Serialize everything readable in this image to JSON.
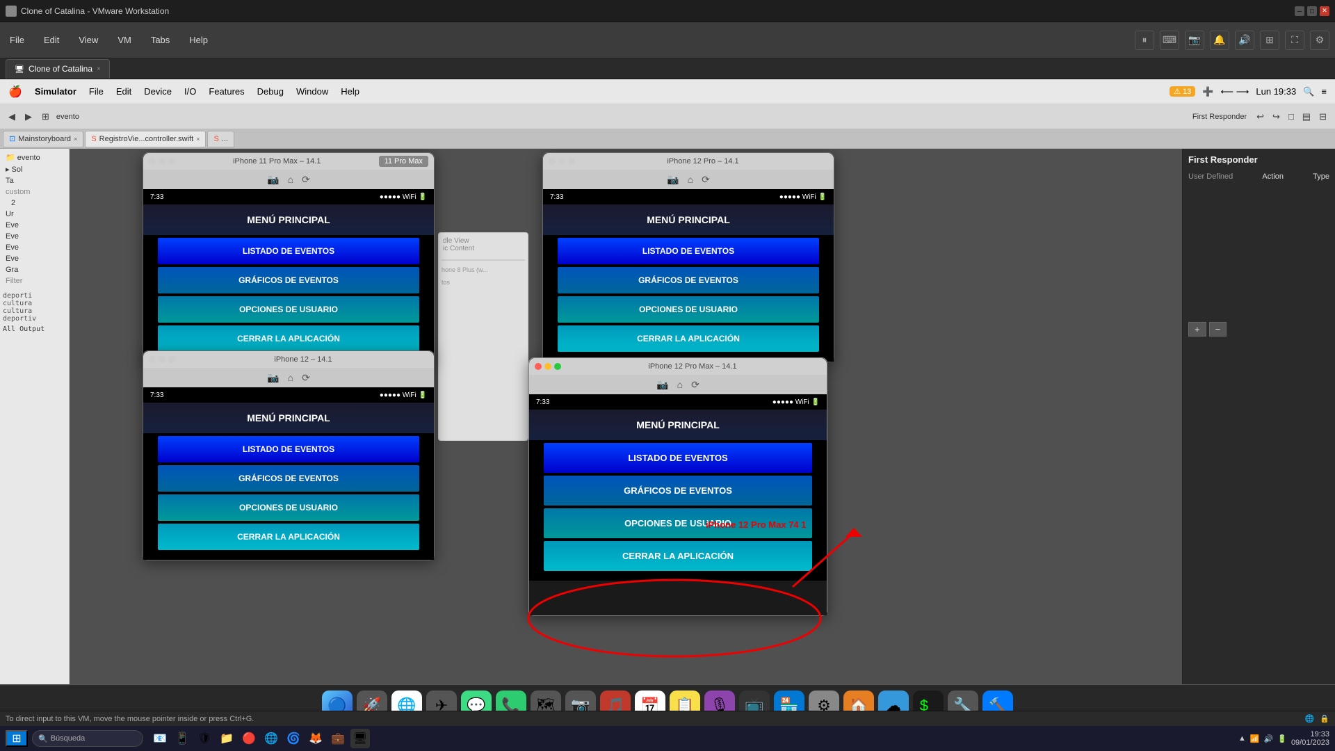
{
  "window": {
    "title": "Clone of Catalina - VMware Workstation",
    "icon": "vmware-icon"
  },
  "vmware_menu": {
    "items": [
      "File",
      "Edit",
      "View",
      "VM",
      "Tabs",
      "Help"
    ]
  },
  "tab": {
    "label": "Clone of Catalina",
    "close_icon": "×"
  },
  "mac_menu": {
    "apple": "🍎",
    "items": [
      "Simulator",
      "File",
      "Edit",
      "Device",
      "I/O",
      "Features",
      "Debug",
      "Window",
      "Help"
    ],
    "time": "Lun 19:33"
  },
  "simulators": [
    {
      "id": "iphone11promax",
      "title": "iPhone 11 Pro Max – 14.1",
      "sim_tab": "11 Pro Max",
      "dots": [
        "red",
        "yellow",
        "green"
      ],
      "status_time": "7:33",
      "menu_title": "MENÚ PRINCIPAL",
      "buttons": [
        {
          "label": "LISTADO DE EVENTOS",
          "style": "blue"
        },
        {
          "label": "GRÁFICOS DE EVENTOS",
          "style": "teal1"
        },
        {
          "label": "OPCIONES DE USUARIO",
          "style": "teal2"
        },
        {
          "label": "CERRAR LA APLICACIÓN",
          "style": "teal3"
        }
      ]
    },
    {
      "id": "iphone12pro",
      "title": "iPhone 12 Pro – 14.1",
      "dots": [
        "gray",
        "gray",
        "gray"
      ],
      "status_time": "7:33",
      "menu_title": "MENÚ PRINCIPAL",
      "buttons": [
        {
          "label": "LISTADO DE EVENTOS",
          "style": "blue"
        },
        {
          "label": "GRÁFICOS DE EVENTOS",
          "style": "teal1"
        },
        {
          "label": "OPCIONES DE USUARIO",
          "style": "teal2"
        },
        {
          "label": "CERRAR LA APLICACIÓN",
          "style": "teal3"
        }
      ]
    },
    {
      "id": "iphone12",
      "title": "iPhone 12 – 14.1",
      "dots": [
        "gray",
        "gray",
        "gray"
      ],
      "status_time": "7:33",
      "menu_title": "MENÚ PRINCIPAL",
      "buttons": [
        {
          "label": "LISTADO DE EVENTOS",
          "style": "blue"
        },
        {
          "label": "GRÁFICOS DE EVENTOS",
          "style": "teal1"
        },
        {
          "label": "OPCIONES DE USUARIO",
          "style": "teal2"
        },
        {
          "label": "CERRAR LA APLICACIÓN",
          "style": "teal3"
        }
      ]
    },
    {
      "id": "iphone12promax",
      "title": "iPhone 12 Pro Max – 14.1",
      "dots": [
        "red",
        "yellow",
        "green"
      ],
      "status_time": "7:33",
      "menu_title": "MENÚ PRINCIPAL",
      "buttons": [
        {
          "label": "LISTADO DE EVENTOS",
          "style": "blue"
        },
        {
          "label": "GRÁFICOS DE EVENTOS",
          "style": "teal1"
        },
        {
          "label": "OPCIONES DE USUARIO",
          "style": "teal2"
        },
        {
          "label": "CERRAR LA APLICACIÓN",
          "style": "teal3"
        }
      ],
      "annotation": "iPhone 12 Pro Max 74 1"
    }
  ],
  "right_panel": {
    "title": "First Responder",
    "subtitle": "User Defined",
    "action_label": "Action",
    "type_label": "Type"
  },
  "sidebar": {
    "items": [
      "evento",
      "Sol",
      "Tab",
      "Ur",
      "Eve",
      "Eve",
      "Eve",
      "Eve",
      "Gra",
      "Filter"
    ]
  },
  "console": {
    "lines": [
      "deporti",
      "cultura",
      "cultura",
      "deportiv",
      "All Output"
    ]
  },
  "file_tabs": [
    {
      "label": "Mainstoryboard",
      "active": false
    },
    {
      "label": "RegistroVie...controller.swift",
      "active": false
    },
    {
      "label": "...",
      "active": false
    }
  ],
  "xcode_toolbar": {
    "buttons": [
      "⬛",
      "▶",
      "◀",
      "≡",
      "↩",
      "↪",
      "⊞",
      "✦"
    ]
  },
  "dock_icons": [
    "🔵",
    "🚀",
    "🌐",
    "✉",
    "💬",
    "📞",
    "🗺",
    "📷",
    "🎵",
    "📅",
    "📋",
    "🎯",
    "⚙",
    "🏠",
    "☁",
    "💻",
    "🔧",
    "🌊",
    "📚",
    "🖊"
  ],
  "taskbar": {
    "start_icon": "⊞",
    "search_placeholder": "Búsqueda",
    "time": "19:33",
    "date": "09/01/2023"
  },
  "status_message": "To direct input to this VM, move the mouse pointer inside or press Ctrl+G."
}
